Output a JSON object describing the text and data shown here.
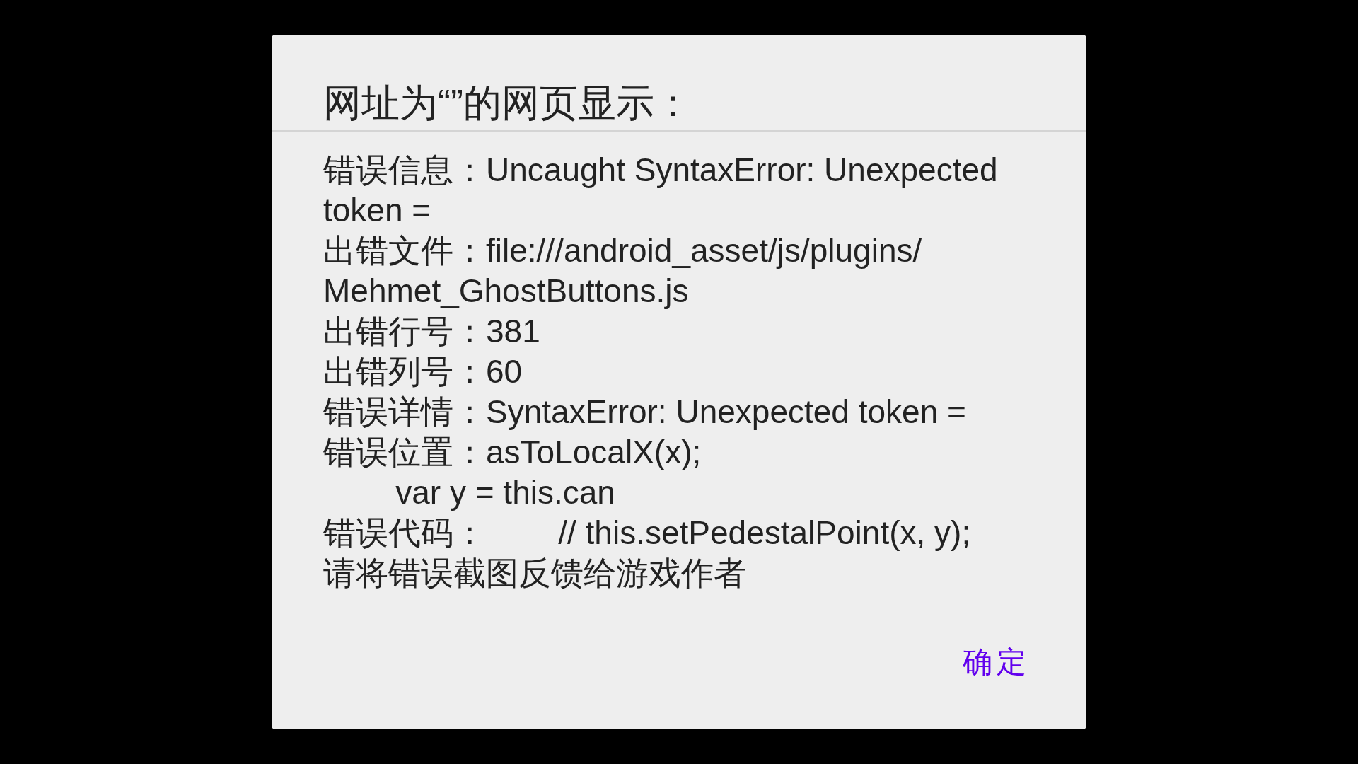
{
  "dialog": {
    "title": "网址为“”的网页显示：",
    "message_lines": [
      "错误信息：Uncaught SyntaxError: Unexpected token =",
      "出错文件：file:///android_asset/js/plugins/Mehmet_GhostButtons.js",
      "出错行号：381",
      "出错列号：60",
      "错误详情：SyntaxError: Unexpected token =",
      "错误位置：asToLocalX(x);\n        var y = this.can",
      "错误代码：        // this.setPedestalPoint(x, y);",
      "请将错误截图反馈给游戏作者"
    ],
    "buttons": [
      {
        "label": "确定"
      }
    ]
  }
}
